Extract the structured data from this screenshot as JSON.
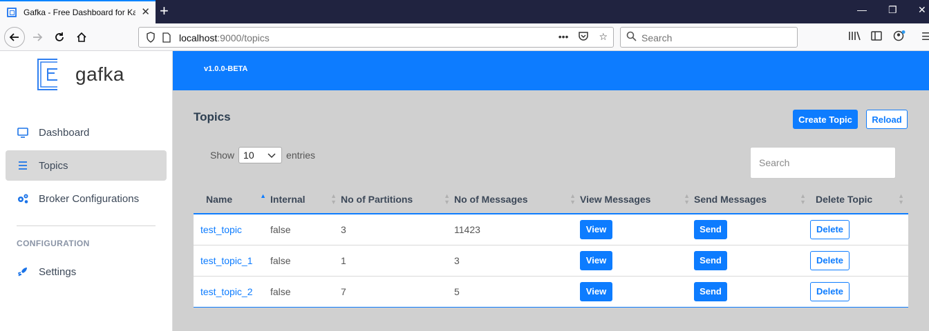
{
  "browser": {
    "tab_title": "Gafka - Free Dashboard for Kafka",
    "url_host": "localhost",
    "url_path": ":9000/topics",
    "search_placeholder": "Search"
  },
  "sidebar": {
    "logo_text": "gafka",
    "items": [
      {
        "label": "Dashboard",
        "icon": "monitor-icon"
      },
      {
        "label": "Topics",
        "icon": "list-icon",
        "active": true
      },
      {
        "label": "Broker Configurations",
        "icon": "gears-icon"
      }
    ],
    "section_heading": "CONFIGURATION",
    "settings_label": "Settings"
  },
  "header": {
    "version": "v1.0.0-BETA"
  },
  "main": {
    "title": "Topics",
    "create_button": "Create Topic",
    "reload_button": "Reload",
    "show_label": "Show",
    "entries_value": "10",
    "entries_label": "entries",
    "search_placeholder": "Search"
  },
  "table": {
    "columns": [
      "Name",
      "Internal",
      "No of Partitions",
      "No of Messages",
      "View Messages",
      "Send Messages",
      "Delete Topic"
    ],
    "rows": [
      {
        "name": "test_topic",
        "internal": "false",
        "partitions": "3",
        "messages": "11423",
        "view": "View",
        "send": "Send",
        "delete": "Delete"
      },
      {
        "name": "test_topic_1",
        "internal": "false",
        "partitions": "1",
        "messages": "3",
        "view": "View",
        "send": "Send",
        "delete": "Delete"
      },
      {
        "name": "test_topic_2",
        "internal": "false",
        "partitions": "7",
        "messages": "5",
        "view": "View",
        "send": "Send",
        "delete": "Delete"
      }
    ]
  },
  "colors": {
    "brand": "#0d7cff",
    "content_bg": "#d0d0d0"
  }
}
